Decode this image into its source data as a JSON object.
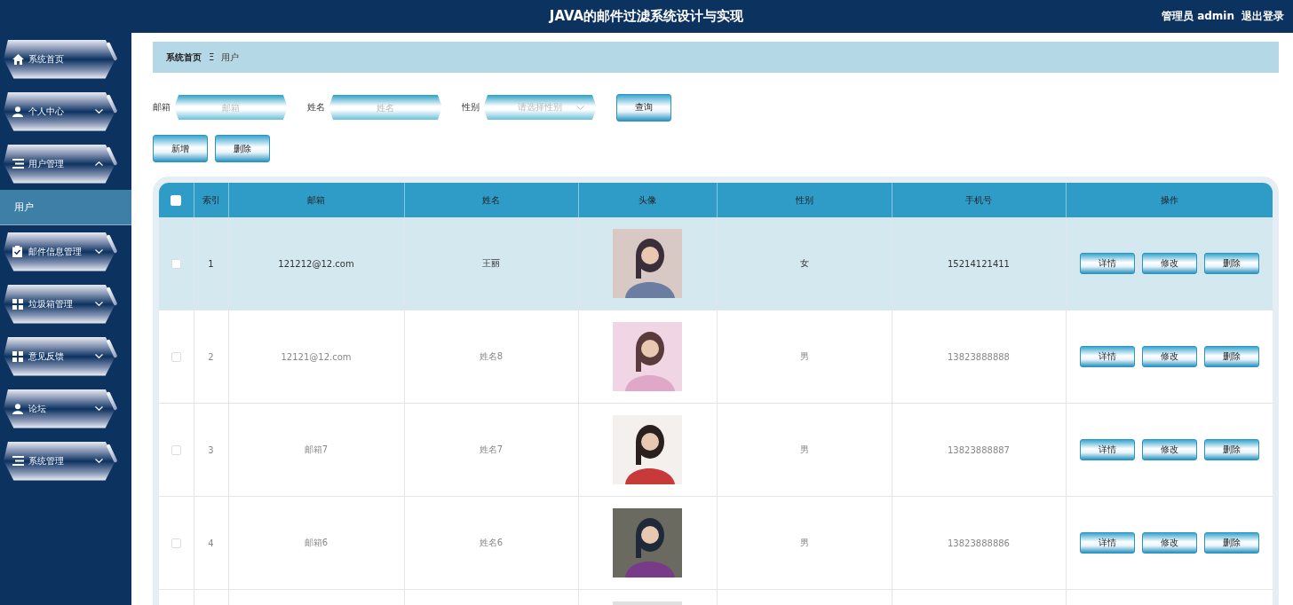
{
  "header": {
    "title": "JAVA的邮件过滤系统设计与实现",
    "user": "管理员 admin",
    "logout": "退出登录"
  },
  "sidebar": {
    "items": [
      {
        "label": "系统首页"
      },
      {
        "label": "个人中心",
        "expanded": false
      },
      {
        "label": "用户管理",
        "expanded": true,
        "children": [
          {
            "label": "用户",
            "selected": true
          }
        ]
      },
      {
        "label": "邮件信息管理",
        "expanded": false
      },
      {
        "label": "垃圾箱管理",
        "expanded": false
      },
      {
        "label": "意见反馈",
        "expanded": false
      },
      {
        "label": "论坛",
        "expanded": false
      },
      {
        "label": "系统管理",
        "expanded": false
      }
    ]
  },
  "breadcrumb": {
    "home": "系统首页",
    "separator": "Ξ",
    "current": "用户"
  },
  "search": {
    "fields": [
      {
        "kind": "input",
        "label": "邮箱",
        "placeholder": "邮箱"
      },
      {
        "kind": "input",
        "label": "姓名",
        "placeholder": "姓名"
      },
      {
        "kind": "select",
        "label": "性别",
        "placeholder": "请选择性别"
      }
    ],
    "button": "查询"
  },
  "actions": [
    "新增",
    "删除"
  ],
  "table": {
    "select_all_checked": false,
    "columns": [
      "索引",
      "邮箱",
      "姓名",
      "头像",
      "性别",
      "手机号",
      "操作"
    ],
    "rows": [
      {
        "index": "1",
        "email": "121212@12.com",
        "name": "王丽",
        "gender": "女",
        "phone": "15214121411",
        "actions": [
          "详情",
          "修改",
          "删除"
        ],
        "hovered": true,
        "checked": false
      },
      {
        "index": "2",
        "email": "12121@12.com",
        "name": "姓名8",
        "gender": "男",
        "phone": "13823888888",
        "actions": [
          "详情",
          "修改",
          "删除"
        ],
        "hovered": false,
        "checked": false
      },
      {
        "index": "3",
        "email": "邮箱7",
        "name": "姓名7",
        "gender": "男",
        "phone": "13823888887",
        "actions": [
          "详情",
          "修改",
          "删除"
        ],
        "hovered": false,
        "checked": false
      },
      {
        "index": "4",
        "email": "邮箱6",
        "name": "姓名6",
        "gender": "男",
        "phone": "13823888886",
        "actions": [
          "详情",
          "修改",
          "删除"
        ],
        "hovered": false,
        "checked": false
      },
      {
        "hovered": false
      }
    ]
  }
}
